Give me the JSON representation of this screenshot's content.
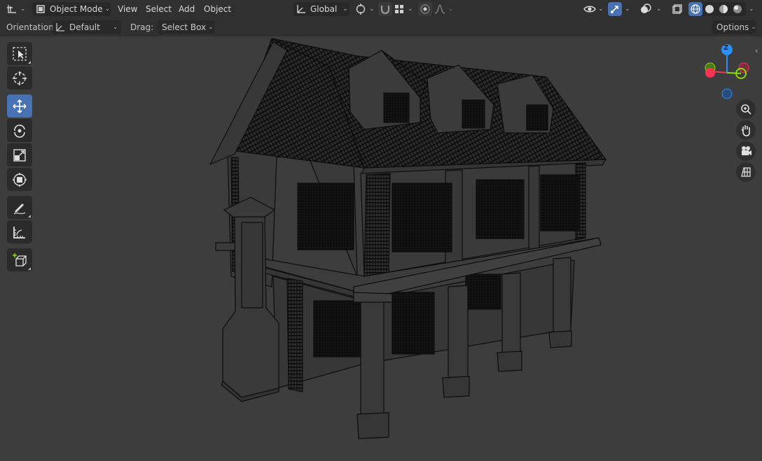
{
  "header": {
    "editor_type_icon": "transform-axes-icon",
    "mode_label": "Object Mode",
    "menu": [
      "View",
      "Select",
      "Add",
      "Object"
    ],
    "transform_orientation": "Global",
    "pivot_icon": "pivot-point-icon",
    "snap_icon": "snap-magnet-icon",
    "snap_target_icon": "snap-increment-icon",
    "proportional_icon": "proportional-edit-icon",
    "falloff_icon": "falloff-curve-icon",
    "visibility_icon": "eye-icon",
    "gizmo_icon": "gizmo-icon",
    "overlay_icon": "overlay-icon",
    "xray_icon": "xray-icon",
    "shading_modes": [
      "wireframe",
      "solid",
      "material-preview",
      "rendered"
    ],
    "active_shading": "wireframe",
    "accent": "#4772b3"
  },
  "tool_settings": {
    "orientation_label": "Orientation:",
    "orientation_value": "Default",
    "drag_label": "Drag:",
    "drag_value": "Select Box",
    "options_label": "Options"
  },
  "toolbar": {
    "tools": [
      {
        "name": "select-box-tool",
        "icon": "select-box-icon",
        "active": false
      },
      {
        "name": "cursor-tool",
        "icon": "cursor-icon",
        "active": false
      },
      {
        "name": "move-tool",
        "icon": "move-icon",
        "active": true
      },
      {
        "name": "rotate-tool",
        "icon": "rotate-icon",
        "active": false
      },
      {
        "name": "scale-tool",
        "icon": "scale-icon",
        "active": false
      },
      {
        "name": "transform-tool",
        "icon": "transform-icon",
        "active": false
      },
      {
        "name": "annotate-tool",
        "icon": "annotate-pencil-icon",
        "active": false
      },
      {
        "name": "measure-tool",
        "icon": "measure-ruler-icon",
        "active": false
      },
      {
        "name": "add-cube-tool",
        "icon": "add-cube-icon",
        "active": false
      }
    ]
  },
  "navigation": {
    "gizmo_axes": [
      "Z"
    ],
    "axis_colors": {
      "x": "#ff3352",
      "y": "#8bdc00",
      "z": "#2890ff"
    },
    "buttons": [
      "zoom-icon",
      "pan-hand-icon",
      "camera-view-icon",
      "ortho-grid-icon"
    ]
  },
  "scene": {
    "object": "wireframe-house-model",
    "wire_color": "#0d0d0d"
  }
}
